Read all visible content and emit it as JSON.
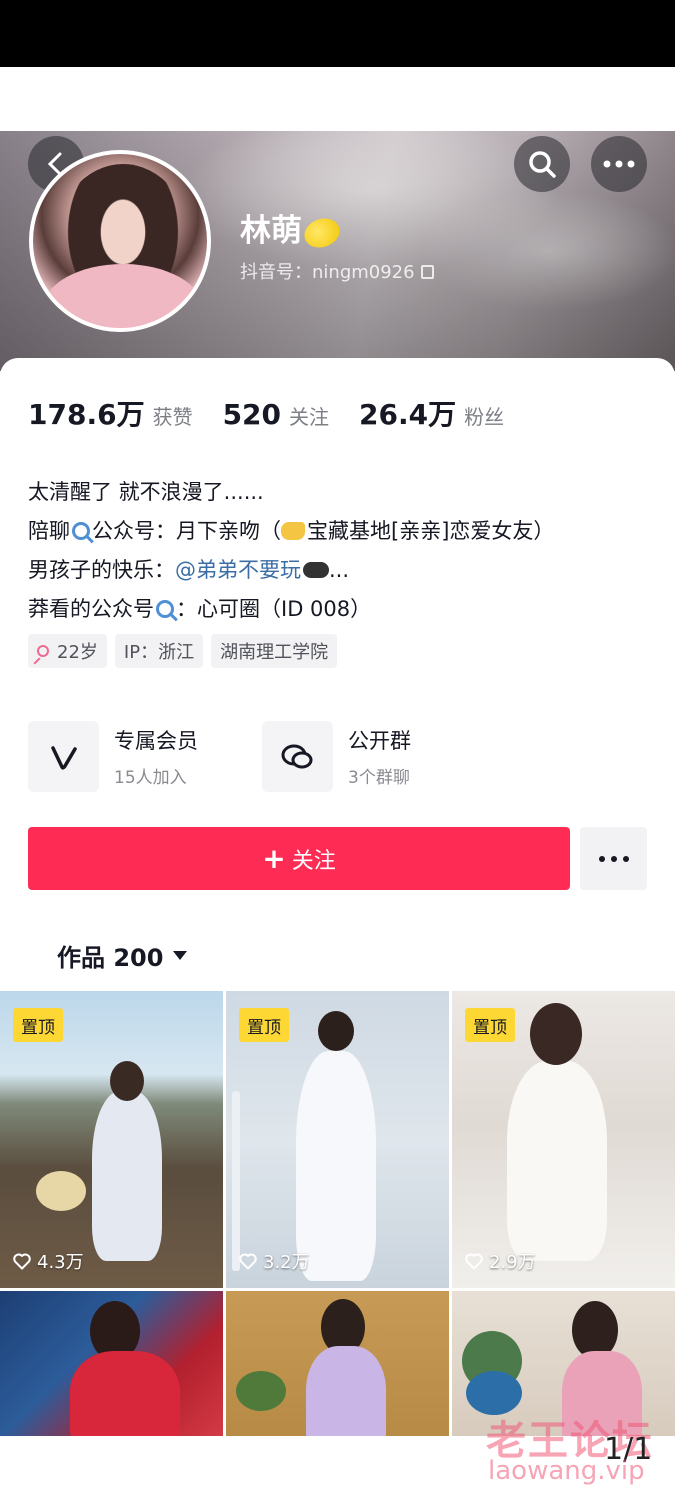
{
  "profile": {
    "name": "林萌",
    "handle_label": "抖音号：ningm0926",
    "stats": [
      {
        "value": "178.6万",
        "label": "获赞"
      },
      {
        "value": "520",
        "label": "关注"
      },
      {
        "value": "26.4万",
        "label": "粉丝"
      }
    ],
    "bio": {
      "line1": "太清醒了 就不浪漫了......",
      "line2_a": "陪聊",
      "line2_b": "公众号：月下亲吻（",
      "line2_c": "宝藏基地[亲亲]恋爱女友）",
      "line3_a": "男孩子的快乐：",
      "line3_link": "@弟弟不要玩",
      "line3_b": "...",
      "line4_a": "莽看的公众号",
      "line4_b": "：心可圈（ID 008）"
    },
    "tags": [
      "22岁",
      "IP：浙江",
      "湖南理工学院"
    ]
  },
  "features": [
    {
      "title": "专属会员",
      "sub": "15人加入",
      "icon": "v-icon"
    },
    {
      "title": "公开群",
      "sub": "3个群聊",
      "icon": "chat-bubbles-icon"
    }
  ],
  "actions": {
    "follow_label": "关注"
  },
  "works": {
    "tab_label": "作品 200"
  },
  "videos": [
    {
      "pin": "置顶",
      "likes": "4.3万"
    },
    {
      "pin": "置顶",
      "likes": "3.2万"
    },
    {
      "pin": "置顶",
      "likes": "2.9万"
    },
    {
      "pin": "",
      "likes": ""
    },
    {
      "pin": "",
      "likes": ""
    },
    {
      "pin": "",
      "likes": ""
    }
  ],
  "overlay": {
    "watermark_cn": "老王论坛",
    "watermark_url": "laowang.vip",
    "pager": "1/1"
  },
  "colors": {
    "accent": "#fe2c55",
    "pin": "#fdd835",
    "link": "#3b6ea5"
  }
}
